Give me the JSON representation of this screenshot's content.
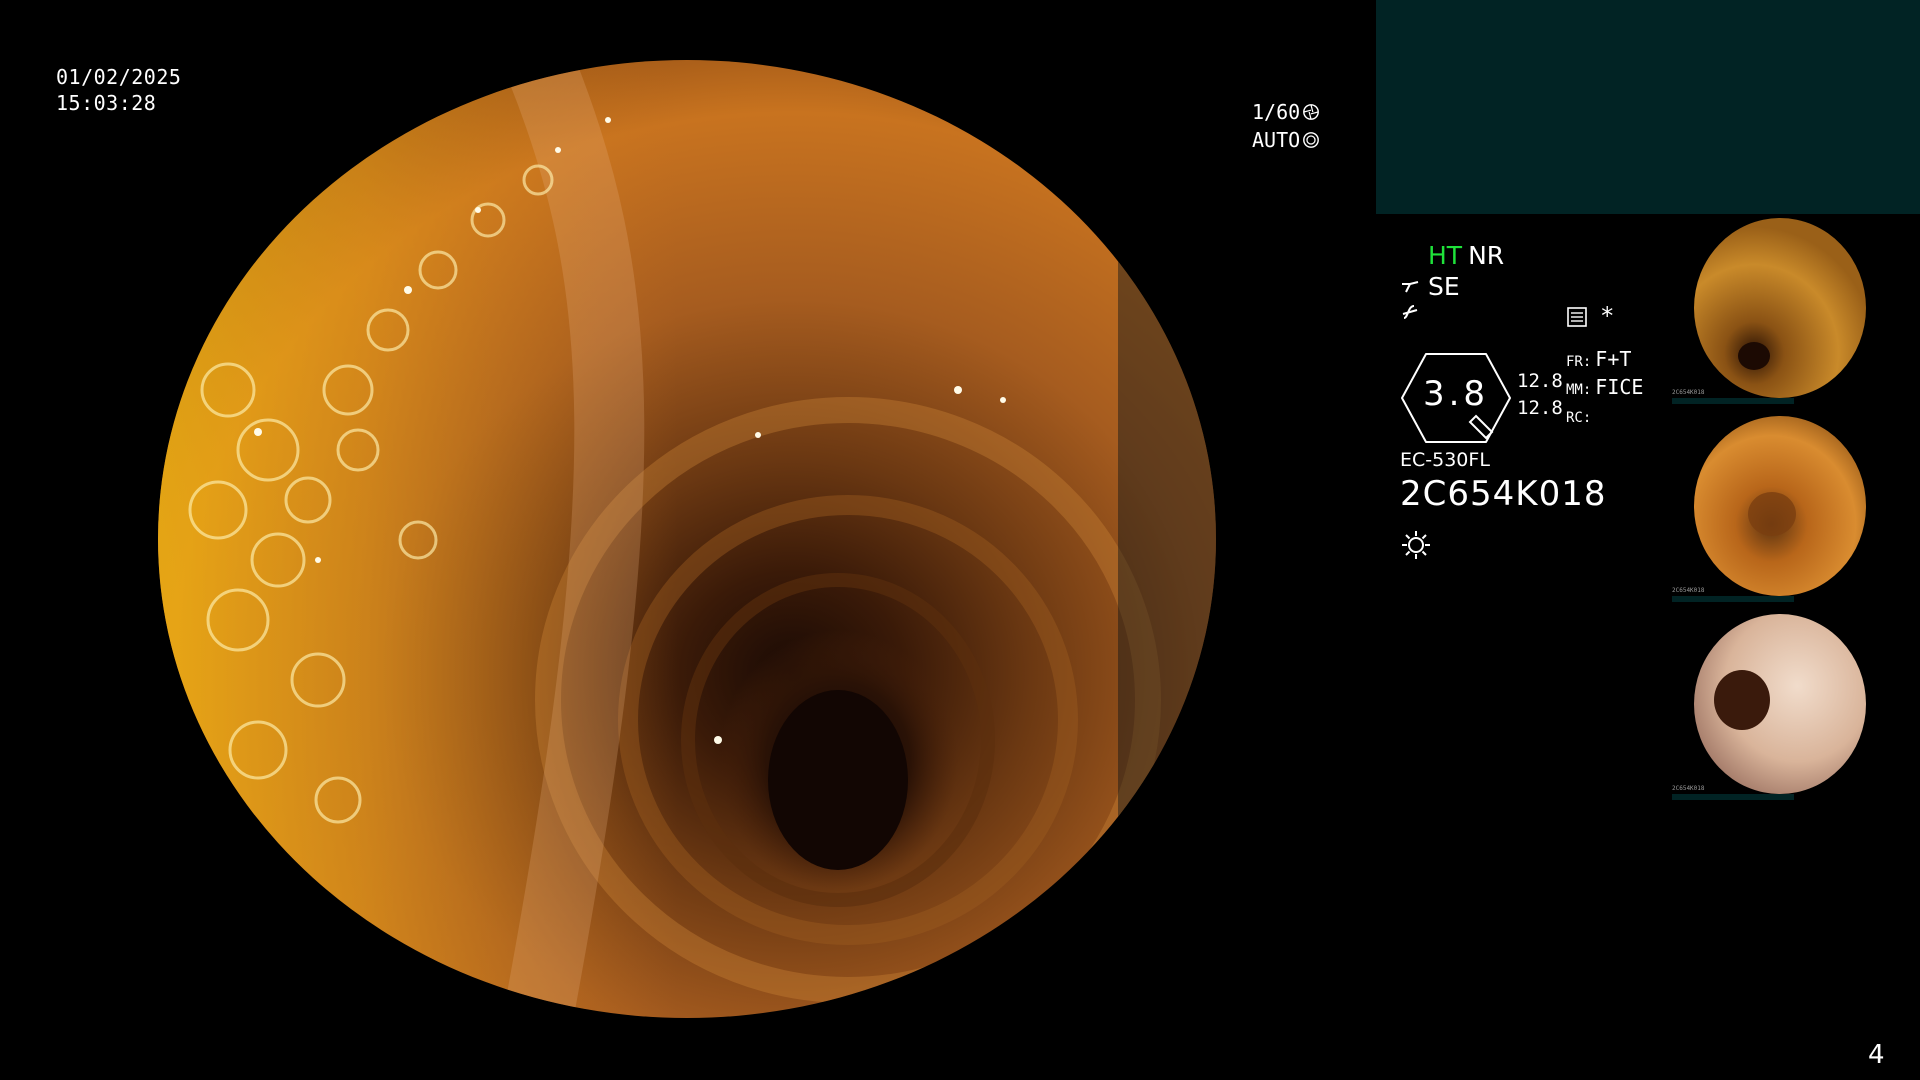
{
  "overlay": {
    "date": "01/02/2025",
    "time": "15:03:28",
    "shutter": "1/60",
    "iris": "AUTO"
  },
  "status": {
    "ht": "HT",
    "nr": "NR",
    "se": "SE",
    "marker": "*"
  },
  "gauge": {
    "value": "3.8",
    "param1": "12.8",
    "param2": "12.8"
  },
  "modes": {
    "fr_label": "FR:",
    "fr_value": "F+T",
    "mm_label": "MM:",
    "mm_value": "FICE",
    "rc_label": "RC:",
    "rc_value": ""
  },
  "scope": {
    "model": "EC-530FL",
    "serial": "2C654K018"
  },
  "thumbnails": [
    {
      "name": "capture-1",
      "meta_serial": "2C654K018"
    },
    {
      "name": "capture-2",
      "meta_serial": "2C654K018"
    },
    {
      "name": "capture-3",
      "meta_serial": "2C654K018"
    }
  ],
  "page": {
    "number": "4"
  },
  "colors": {
    "panel_bg": "#012324",
    "ht_green": "#1fe23a",
    "mucosa": "#c8731f"
  }
}
